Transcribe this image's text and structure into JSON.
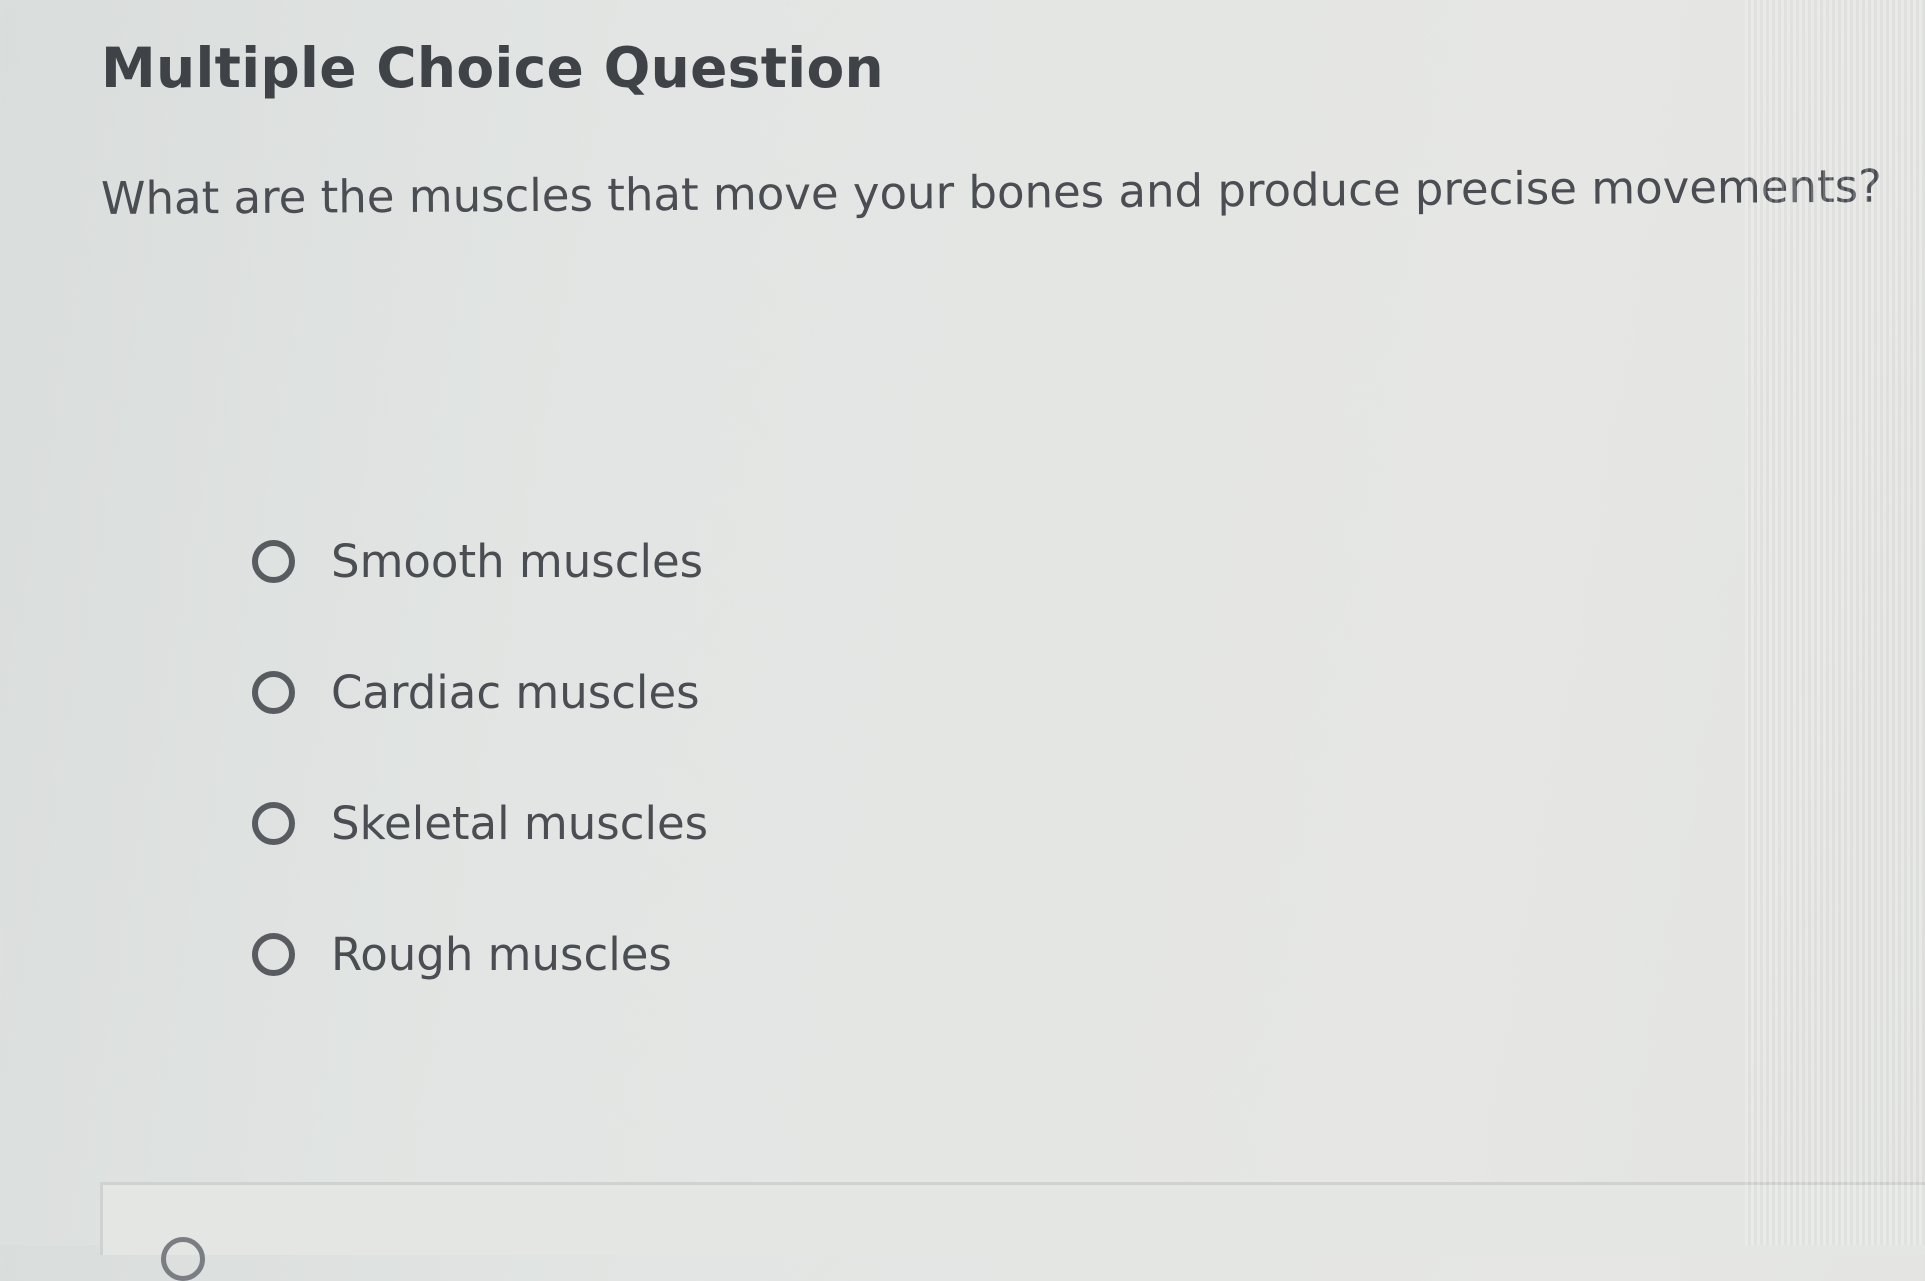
{
  "question": {
    "heading": "Multiple Choice Question",
    "prompt": "What are the muscles that move your bones and produce precise movements?",
    "options": [
      {
        "label": "Smooth muscles",
        "selected": false
      },
      {
        "label": "Cardiac muscles",
        "selected": false
      },
      {
        "label": "Skeletal muscles",
        "selected": false
      },
      {
        "label": "Rough muscles",
        "selected": false
      }
    ]
  },
  "colors": {
    "text": "#4a4e53",
    "heading": "#3f4348",
    "radio_border": "#585c60",
    "background": "#e2e5e3"
  },
  "icons": {
    "radio": "radio-unselected-icon"
  }
}
